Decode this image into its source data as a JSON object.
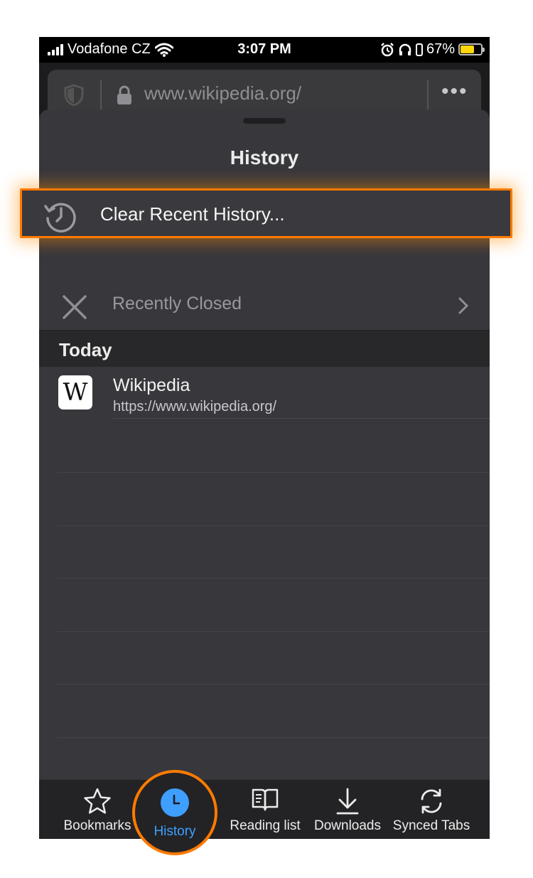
{
  "status_bar": {
    "carrier": "Vodafone CZ",
    "time": "3:07 PM",
    "battery": "67%",
    "battery_level": 0.67
  },
  "url_bar": {
    "url": "www.wikipedia.org/",
    "more_label": "•••"
  },
  "sheet": {
    "title": "History",
    "clear_history_label": "Clear Recent History...",
    "recently_closed_label": "Recently Closed",
    "section_today": "Today",
    "items": [
      {
        "title": "Wikipedia",
        "url": "https://www.wikipedia.org/",
        "favicon_letter": "W"
      }
    ]
  },
  "tab_bar": {
    "tabs": [
      {
        "label": "Bookmarks",
        "icon": "star-icon"
      },
      {
        "label": "History",
        "icon": "clock-icon",
        "active": true
      },
      {
        "label": "Reading list",
        "icon": "book-icon"
      },
      {
        "label": "Downloads",
        "icon": "download-icon"
      },
      {
        "label": "Synced Tabs",
        "icon": "sync-icon"
      }
    ]
  },
  "colors": {
    "accent": "#3e9fff",
    "highlight": "#ff7a00",
    "sheet_bg": "#38373c"
  }
}
